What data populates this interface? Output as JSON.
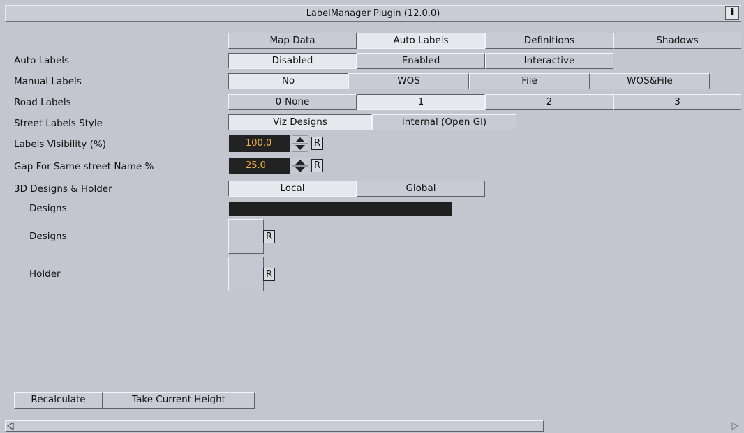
{
  "window": {
    "title": "LabelManager Plugin (12.0.0)",
    "info_label": "i"
  },
  "tabs": [
    {
      "label": "Map Data",
      "selected": false
    },
    {
      "label": "Auto Labels",
      "selected": true
    },
    {
      "label": "Definitions",
      "selected": false
    },
    {
      "label": "Shadows",
      "selected": false
    }
  ],
  "rows": {
    "auto_labels": {
      "label": "Auto Labels",
      "options": [
        "Disabled",
        "Enabled",
        "Interactive"
      ],
      "selected": "Disabled"
    },
    "manual_labels": {
      "label": "Manual Labels",
      "options": [
        "No",
        "WOS",
        "File",
        "WOS&File"
      ],
      "selected": "No"
    },
    "road_labels": {
      "label": "Road Labels",
      "options": [
        "0-None",
        "1",
        "2",
        "3"
      ],
      "selected": "1"
    },
    "street_style": {
      "label": "Street Labels Style",
      "options": [
        "Viz Designs",
        "Internal (Open Gl)"
      ],
      "selected": "Viz Designs"
    },
    "labels_visibility": {
      "label": "Labels Visibility (%)",
      "value": "100.0",
      "reset": "R"
    },
    "gap_same_street": {
      "label": "Gap For Same street Name %",
      "value": "25.0",
      "reset": "R"
    },
    "designs_holder": {
      "label": "3D Designs & Holder",
      "options": [
        "Local",
        "Global"
      ],
      "selected": "Local"
    },
    "designs_field": {
      "label": "Designs"
    },
    "designs_drop": {
      "label": "Designs",
      "reset": "R"
    },
    "holder_drop": {
      "label": "Holder",
      "reset": "R"
    }
  },
  "bottom_buttons": {
    "recalculate": "Recalculate",
    "take_height": "Take Current Height"
  },
  "colors": {
    "background": "#c3c6ce",
    "value_text": "#f0b13c",
    "field_dark": "#222222",
    "selected_button": "#e6e8ed"
  },
  "scrollbar": {
    "position_fraction": 0.0,
    "visible_fraction": 0.73
  }
}
